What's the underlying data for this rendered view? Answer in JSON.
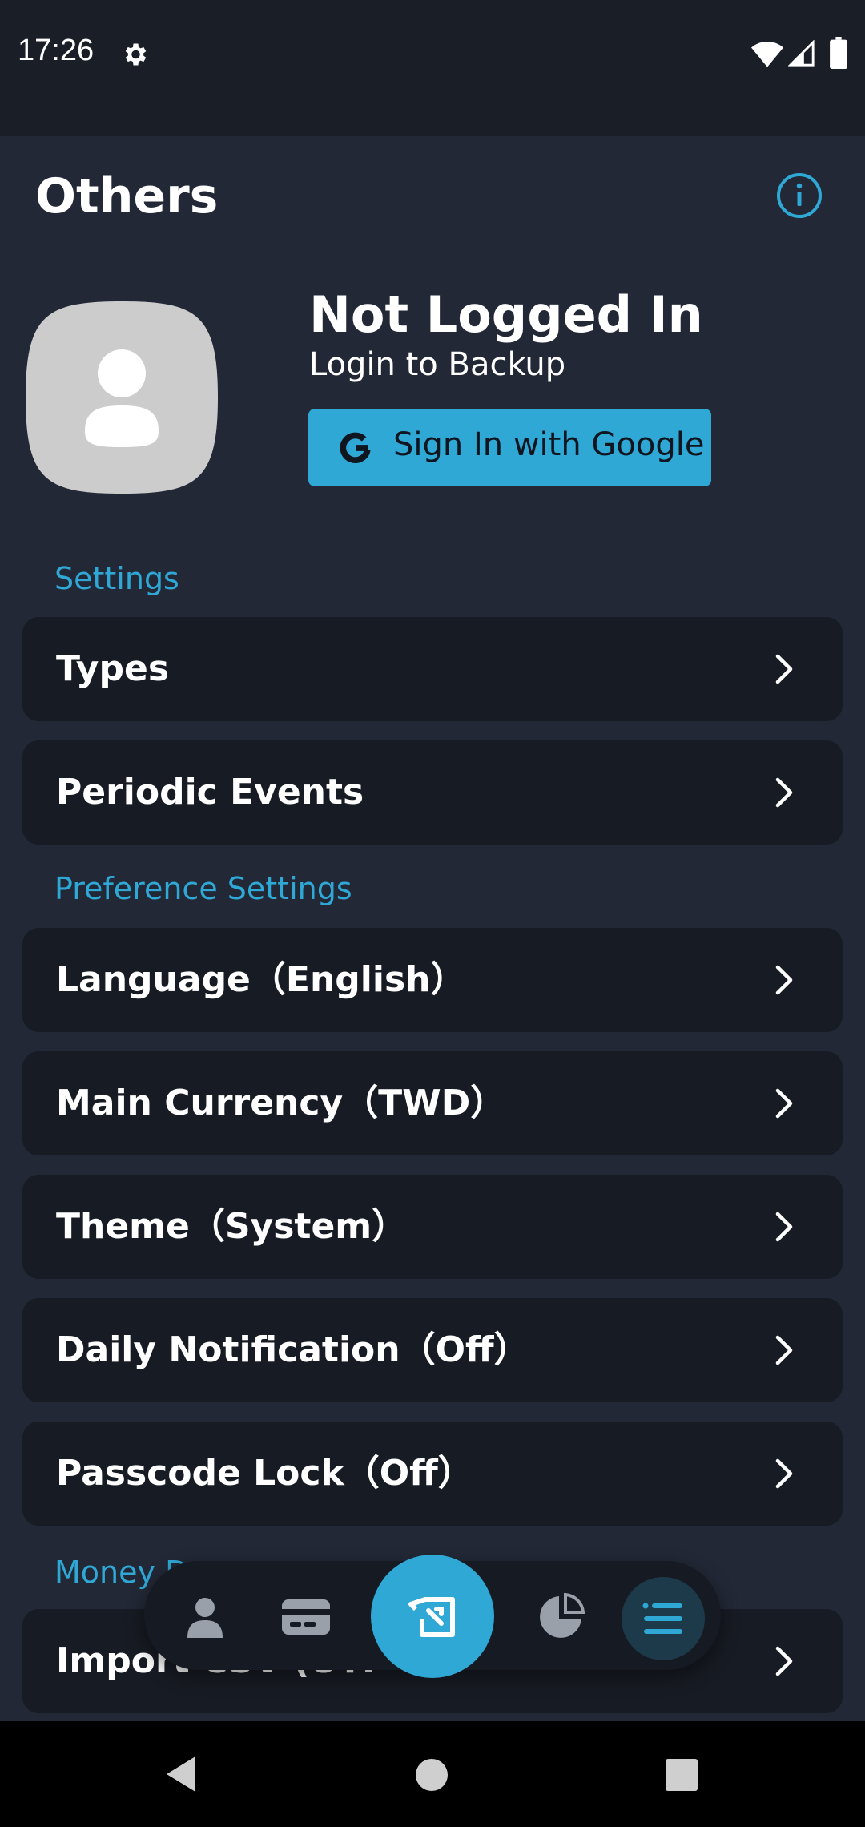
{
  "status_bar": {
    "time": "17:26",
    "icons": [
      "gear-icon",
      "wifi-icon",
      "signal-icon",
      "battery-icon"
    ]
  },
  "header": {
    "title": "Others",
    "info_icon": "info-icon"
  },
  "profile": {
    "name": "Not Logged In",
    "subtitle": "Login to Backup",
    "google_button_label": "Sign In with Google",
    "avatar_icon": "user-avatar-icon"
  },
  "sections": {
    "settings": {
      "title": "Settings",
      "items": [
        {
          "label": "Types"
        },
        {
          "label": "Periodic Events"
        }
      ]
    },
    "preferences": {
      "title": "Preference Settings",
      "items": [
        {
          "label": "Language（English）"
        },
        {
          "label": "Main Currency（TWD）"
        },
        {
          "label": "Theme（System）"
        },
        {
          "label": "Daily Notification（Off）"
        },
        {
          "label": "Passcode Lock（Off）"
        }
      ]
    },
    "money": {
      "title": "Money D",
      "items": [
        {
          "label": "Import CSV (UTF-8)"
        }
      ]
    }
  },
  "bottom_nav": {
    "items": [
      "person-icon",
      "card-icon",
      "add-record-icon",
      "pie-chart-icon",
      "menu-icon"
    ],
    "active": "menu-icon"
  },
  "colors": {
    "accent": "#2fa8d6",
    "background": "#222836",
    "row": "#171b23",
    "status_bar": "#1a1e27"
  }
}
